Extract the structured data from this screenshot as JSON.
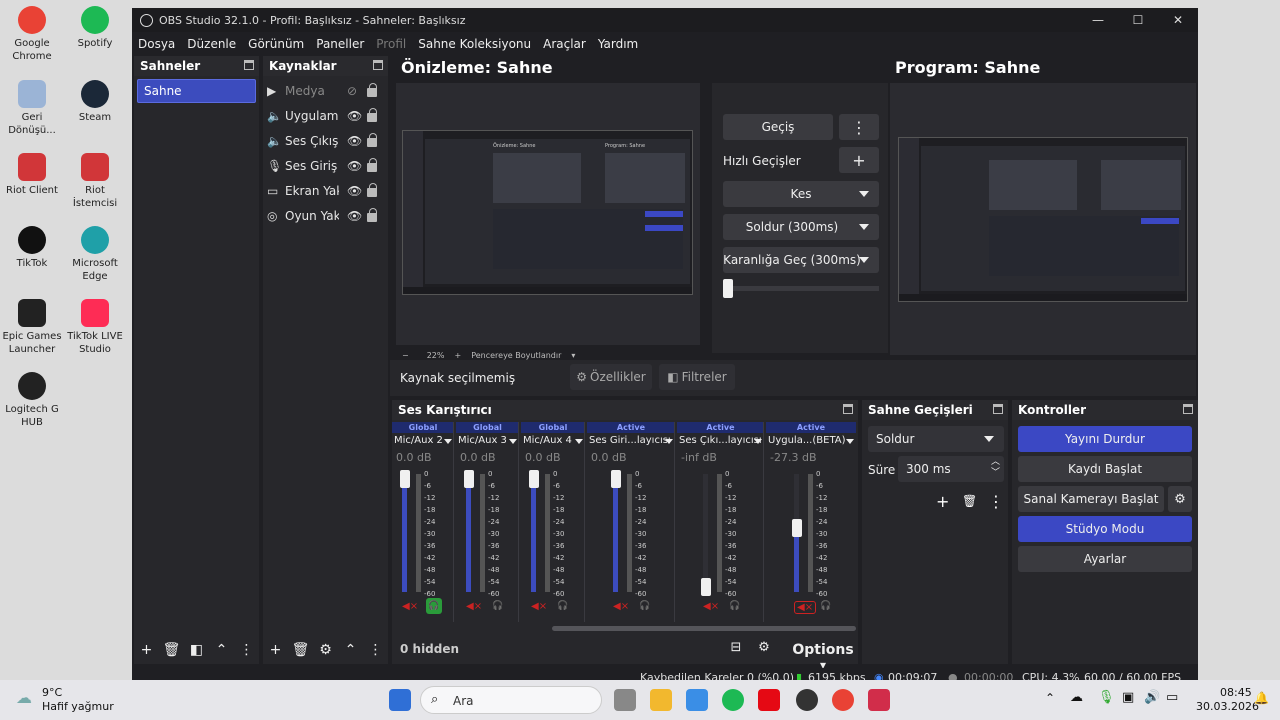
{
  "desktop": {
    "icons": [
      {
        "label": "Google Chrome",
        "color": "#e94235"
      },
      {
        "label": "Spotify",
        "color": "#1db954"
      },
      {
        "label": "Geri Dönüşü...",
        "color": "#6a8fbf"
      },
      {
        "label": "Steam",
        "color": "#1b2838"
      },
      {
        "label": "Riot Client",
        "color": "#d13639"
      },
      {
        "label": "Riot İstemcisi",
        "color": "#d13639"
      },
      {
        "label": "TikTok",
        "color": "#111111"
      },
      {
        "label": "Microsoft Edge",
        "color": "#1fa0a8"
      },
      {
        "label": "Epic Games Launcher",
        "color": "#222222"
      },
      {
        "label": "TikTok LIVE Studio",
        "color": "#fe2c55"
      },
      {
        "label": "Logitech G HUB",
        "color": "#222222"
      }
    ]
  },
  "window": {
    "title": "OBS Studio 32.1.0 - Profil: Başlıksız - Sahneler: Başlıksız",
    "controls": {
      "minimize": "—",
      "maximize": "☐",
      "close": "✕"
    }
  },
  "menu": [
    "Dosya",
    "Düzenle",
    "Görünüm",
    "Paneller",
    "Profil",
    "Sahne Koleksiyonu",
    "Araçlar",
    "Yardım"
  ],
  "scenes": {
    "header": "Sahneler",
    "items": [
      "Sahne"
    ]
  },
  "sources": {
    "header": "Kaynaklar",
    "items": [
      {
        "name": "Medya",
        "icon": "play-icon"
      },
      {
        "name": "Uygulama",
        "icon": "speaker-icon"
      },
      {
        "name": "Ses Çıkış Y",
        "icon": "speaker-icon"
      },
      {
        "name": "Ses Giriş Y",
        "icon": "mic-icon"
      },
      {
        "name": "Ekran Yak",
        "icon": "monitor-icon"
      },
      {
        "name": "Oyun Yak",
        "icon": "gamepad-icon"
      }
    ]
  },
  "preview": {
    "title": "Önizleme: Sahne",
    "zoom": "22%",
    "zoom_minus": "−",
    "zoom_plus": "+",
    "fit_label": "Pencereye Boyutlandır",
    "inner_left_title": "Önizleme: Sahne",
    "inner_right_title": "Program: Sahne"
  },
  "program": {
    "title": "Program: Sahne"
  },
  "transitions_mid": {
    "gecis": "Geçiş",
    "more": "⋮",
    "quick_label": "Hızlı Geçişler",
    "add": "+",
    "kes": "Kes",
    "soldur": "Soldur (300ms)",
    "karanlik": "Karanlığa Geç (300ms)"
  },
  "source_bar": {
    "none_selected": "Kaynak seçilmemiş",
    "properties": "Özellikler",
    "filters": "Filtreler"
  },
  "mixer": {
    "header": "Ses Karıştırıcı",
    "channels": [
      {
        "tag": "Global",
        "name": "Mic/Aux 2",
        "db": "0.0 dB",
        "level": 1.0
      },
      {
        "tag": "Global",
        "name": "Mic/Aux 3",
        "db": "0.0 dB",
        "level": 1.0
      },
      {
        "tag": "Global",
        "name": "Mic/Aux 4",
        "db": "0.0 dB",
        "level": 1.0
      },
      {
        "tag": "Active",
        "name": "Ses Giri...layıcısı",
        "db": "0.0 dB",
        "level": 1.0
      },
      {
        "tag": "Active",
        "name": "Ses Çıkı...layıcısı",
        "db": "-inf dB",
        "level": 0.0
      },
      {
        "tag": "Active",
        "name": "Uygula...(BETA)",
        "db": "-27.3 dB",
        "level": 0.55
      }
    ],
    "ticks": [
      "0",
      "-6",
      "-12",
      "-18",
      "-24",
      "-30",
      "-36",
      "-42",
      "-48",
      "-54",
      "-60"
    ],
    "hidden": "0 hidden",
    "options": "Options"
  },
  "scene_transitions": {
    "header": "Sahne Geçişleri",
    "selected": "Soldur",
    "duration_label": "Süre",
    "duration": "300 ms",
    "add": "+",
    "more": "⋮"
  },
  "controls": {
    "header": "Kontroller",
    "stop_stream": "Yayını Durdur",
    "start_record": "Kaydı Başlat",
    "virtual_cam": "Sanal Kamerayı Başlat",
    "studio_mode": "Stüdyo Modu",
    "settings": "Ayarlar"
  },
  "status": {
    "dropped": "Kaybedilen Kareler 0 (%0.0)",
    "bitrate": "6195 kbps",
    "stream_time": "00:09:07",
    "rec_time": "00:00:00",
    "cpu": "CPU: 4.3%",
    "fps": "60.00 / 60.00 FPS"
  },
  "taskbar": {
    "weather_temp": "9°C",
    "weather_desc": "Hafif yağmur",
    "search": "Ara",
    "time": "08:45",
    "date": "30.03.2026"
  }
}
